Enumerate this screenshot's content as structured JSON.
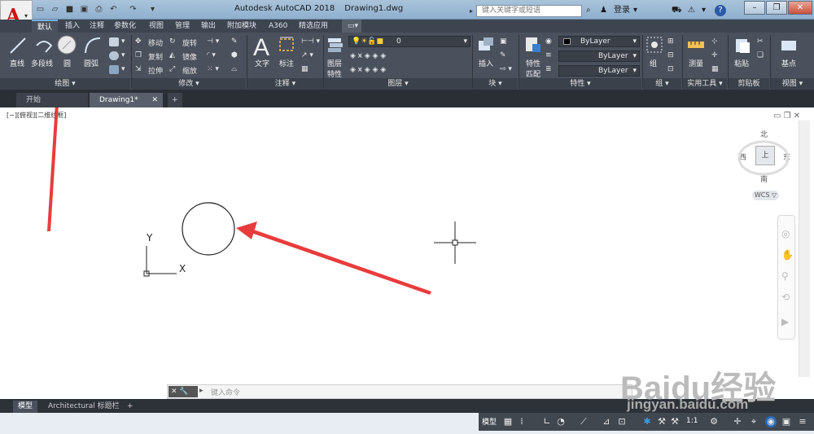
{
  "titlebar": {
    "app_name": "Autodesk AutoCAD 2018",
    "file_name": "Drawing1.dwg",
    "search_placeholder": "键入关键字或短语",
    "login": "登录",
    "help": "?"
  },
  "ribbon_tabs": [
    "默认",
    "插入",
    "注释",
    "参数化",
    "视图",
    "管理",
    "输出",
    "附加模块",
    "A360",
    "精选应用"
  ],
  "ribbon": {
    "draw": {
      "line": "直线",
      "polyline": "多段线",
      "circle": "圆",
      "arc": "圆弧",
      "panel": "绘图 ▾"
    },
    "modify": {
      "move": "移动",
      "rotate": "旋转",
      "copy": "复制",
      "mirror": "镜像",
      "stretch": "拉伸",
      "scale": "缩放",
      "panel": "修改 ▾"
    },
    "annotation": {
      "text": "文字",
      "dimension": "标注",
      "panel": "注释 ▾"
    },
    "layers": {
      "props": "图层",
      "props2": "特性",
      "layer_value": "0",
      "panel": "图层 ▾"
    },
    "block": {
      "insert": "插入",
      "panel": "块 ▾"
    },
    "properties": {
      "match": "特性",
      "match2": "匹配",
      "bylayer1": "ByLayer",
      "bylayer2": "ByLayer",
      "bylayer3": "ByLayer",
      "panel": "特性 ▾"
    },
    "groups": {
      "group": "组",
      "panel": "组 ▾"
    },
    "utilities": {
      "measure": "测量",
      "panel": "实用工具 ▾"
    },
    "clipboard": {
      "paste": "粘贴",
      "panel": "剪贴板"
    },
    "view": {
      "base": "基点",
      "panel": "视图 ▾"
    }
  },
  "doc_tabs": {
    "start": "开始",
    "drawing": "Drawing1*",
    "add": "+"
  },
  "viewport": {
    "label": "[−][俯视][二维线框]",
    "compass": {
      "north": "北",
      "south": "南",
      "east": "东",
      "west": "西",
      "center": "上"
    },
    "wcs": "WCS ▽",
    "ucs_x": "X",
    "ucs_y": "Y"
  },
  "command": {
    "placeholder": "键入命令",
    "close": "✕",
    "wrench": "🔧",
    "prompt": "▸"
  },
  "layout_tabs": {
    "model": "模型",
    "layout": "Architectural 标题栏",
    "add": "+"
  },
  "status": {
    "model": "模型",
    "scale": "1:1"
  },
  "watermark": {
    "brand": "Baidu经验",
    "url": "jingyan.baidu.com"
  },
  "colors": {
    "accent": "#e83c3c",
    "ribbon_bg": "#4a505c",
    "title_bg": "#9db8d3",
    "circle": "#222222"
  }
}
